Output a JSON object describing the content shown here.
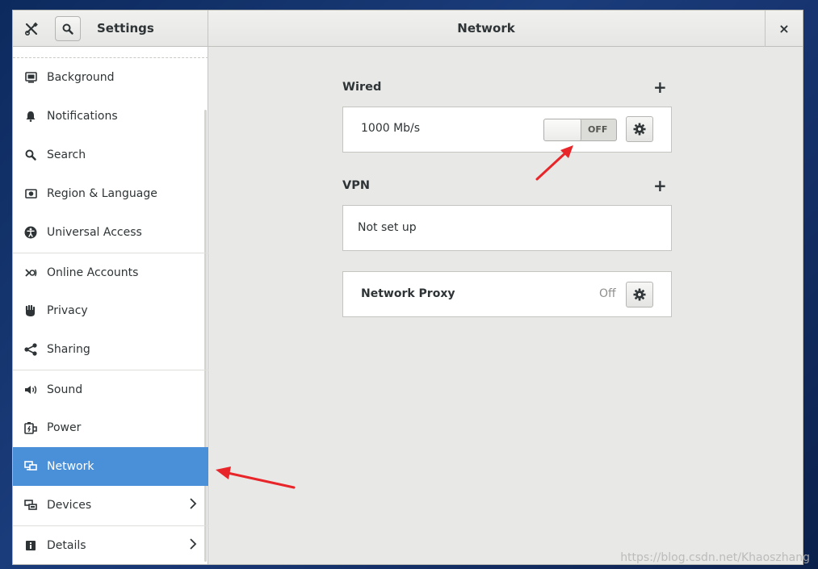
{
  "headerbar": {
    "app_title": "Settings",
    "panel_title": "Network",
    "close_label": "×"
  },
  "sidebar": {
    "items": [
      {
        "label": "Background",
        "icon": "background-icon"
      },
      {
        "label": "Notifications",
        "icon": "bell-icon"
      },
      {
        "label": "Search",
        "icon": "search-icon"
      },
      {
        "label": "Region & Language",
        "icon": "region-icon"
      },
      {
        "label": "Universal Access",
        "icon": "accessibility-icon"
      },
      {
        "label": "Online Accounts",
        "icon": "online-accounts-icon"
      },
      {
        "label": "Privacy",
        "icon": "hand-icon"
      },
      {
        "label": "Sharing",
        "icon": "share-icon"
      },
      {
        "label": "Sound",
        "icon": "speaker-icon"
      },
      {
        "label": "Power",
        "icon": "power-icon"
      },
      {
        "label": "Network",
        "icon": "network-icon",
        "active": true
      },
      {
        "label": "Devices",
        "icon": "devices-icon",
        "has_submenu": true
      },
      {
        "label": "Details",
        "icon": "info-icon",
        "has_submenu": true
      }
    ],
    "accent_color": "#4a90d9"
  },
  "wired": {
    "title": "Wired",
    "add_label": "+",
    "speed": "1000 Mb/s",
    "switch_label": "OFF"
  },
  "vpn": {
    "title": "VPN",
    "add_label": "+",
    "status": "Not set up"
  },
  "proxy": {
    "title": "Network Proxy",
    "status": "Off"
  },
  "watermark": "https://blog.csdn.net/Khaoszhang"
}
